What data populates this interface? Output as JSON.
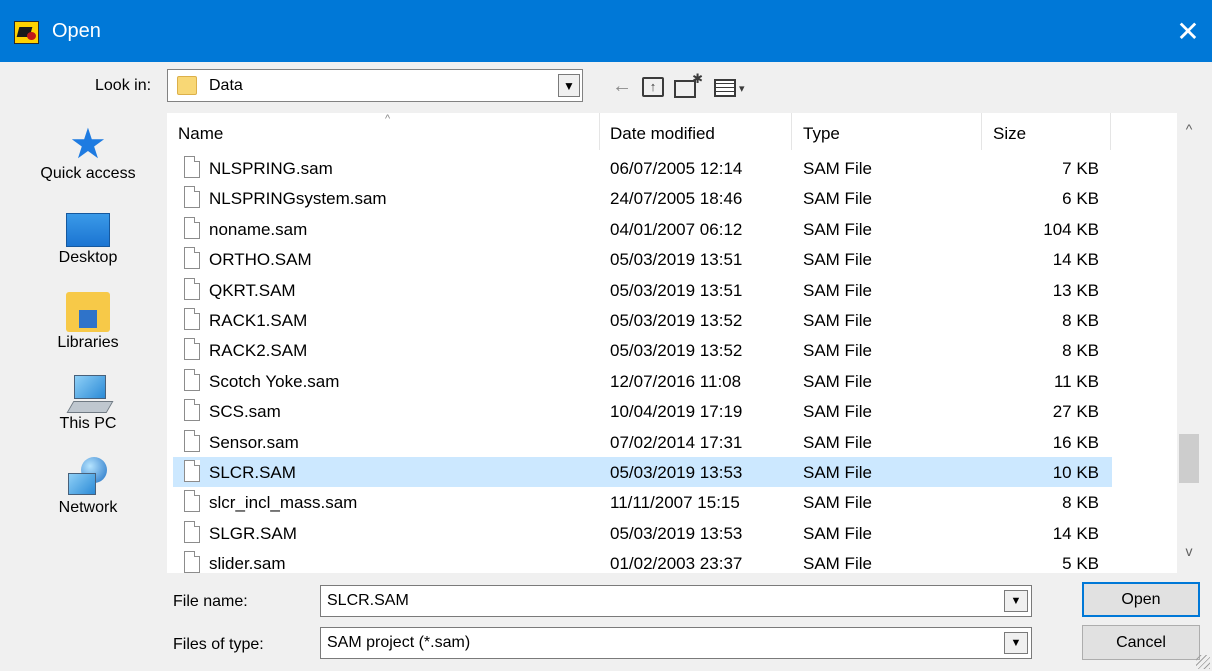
{
  "window": {
    "title": "Open",
    "close_glyph": "✕"
  },
  "toolbar": {
    "look_in_label": "Look in:",
    "look_in_value": "Data",
    "back_glyph": "←",
    "up_glyph": "↑",
    "new_glyph": "✱",
    "view_arrow_glyph": "▾"
  },
  "places": [
    {
      "label": "Quick access",
      "icon": "star-icon"
    },
    {
      "label": "Desktop",
      "icon": "desktop-icon"
    },
    {
      "label": "Libraries",
      "icon": "libraries-icon"
    },
    {
      "label": "This PC",
      "icon": "computer-icon"
    },
    {
      "label": "Network",
      "icon": "network-icon"
    }
  ],
  "columns": {
    "name": "Name",
    "date": "Date modified",
    "type": "Type",
    "size": "Size",
    "sort_glyph": "^"
  },
  "files": [
    {
      "name": "NLSPRING.sam",
      "date": "06/07/2005 12:14",
      "type": "SAM File",
      "size": "7 KB"
    },
    {
      "name": "NLSPRINGsystem.sam",
      "date": "24/07/2005 18:46",
      "type": "SAM File",
      "size": "6 KB"
    },
    {
      "name": "noname.sam",
      "date": "04/01/2007 06:12",
      "type": "SAM File",
      "size": "104 KB"
    },
    {
      "name": "ORTHO.SAM",
      "date": "05/03/2019 13:51",
      "type": "SAM File",
      "size": "14 KB"
    },
    {
      "name": "QKRT.SAM",
      "date": "05/03/2019 13:51",
      "type": "SAM File",
      "size": "13 KB"
    },
    {
      "name": "RACK1.SAM",
      "date": "05/03/2019 13:52",
      "type": "SAM File",
      "size": "8 KB"
    },
    {
      "name": "RACK2.SAM",
      "date": "05/03/2019 13:52",
      "type": "SAM File",
      "size": "8 KB"
    },
    {
      "name": "Scotch Yoke.sam",
      "date": "12/07/2016 11:08",
      "type": "SAM File",
      "size": "11 KB"
    },
    {
      "name": "SCS.sam",
      "date": "10/04/2019 17:19",
      "type": "SAM File",
      "size": "27 KB"
    },
    {
      "name": "Sensor.sam",
      "date": "07/02/2014 17:31",
      "type": "SAM File",
      "size": "16 KB"
    },
    {
      "name": "SLCR.SAM",
      "date": "05/03/2019 13:53",
      "type": "SAM File",
      "size": "10 KB"
    },
    {
      "name": "slcr_incl_mass.sam",
      "date": "11/11/2007 15:15",
      "type": "SAM File",
      "size": "8 KB"
    },
    {
      "name": "SLGR.SAM",
      "date": "05/03/2019 13:53",
      "type": "SAM File",
      "size": "14 KB"
    },
    {
      "name": "slider.sam",
      "date": "01/02/2003 23:37",
      "type": "SAM File",
      "size": "5 KB"
    }
  ],
  "selected_index": 10,
  "scrollbar": {
    "up_glyph": "^",
    "down_glyph": "v"
  },
  "file_name": {
    "label": "File name:",
    "value": "SLCR.SAM"
  },
  "file_type": {
    "label": "Files of type:",
    "value": "SAM project (*.sam)"
  },
  "dropdown_glyph": "▼",
  "buttons": {
    "open": "Open",
    "cancel": "Cancel"
  }
}
